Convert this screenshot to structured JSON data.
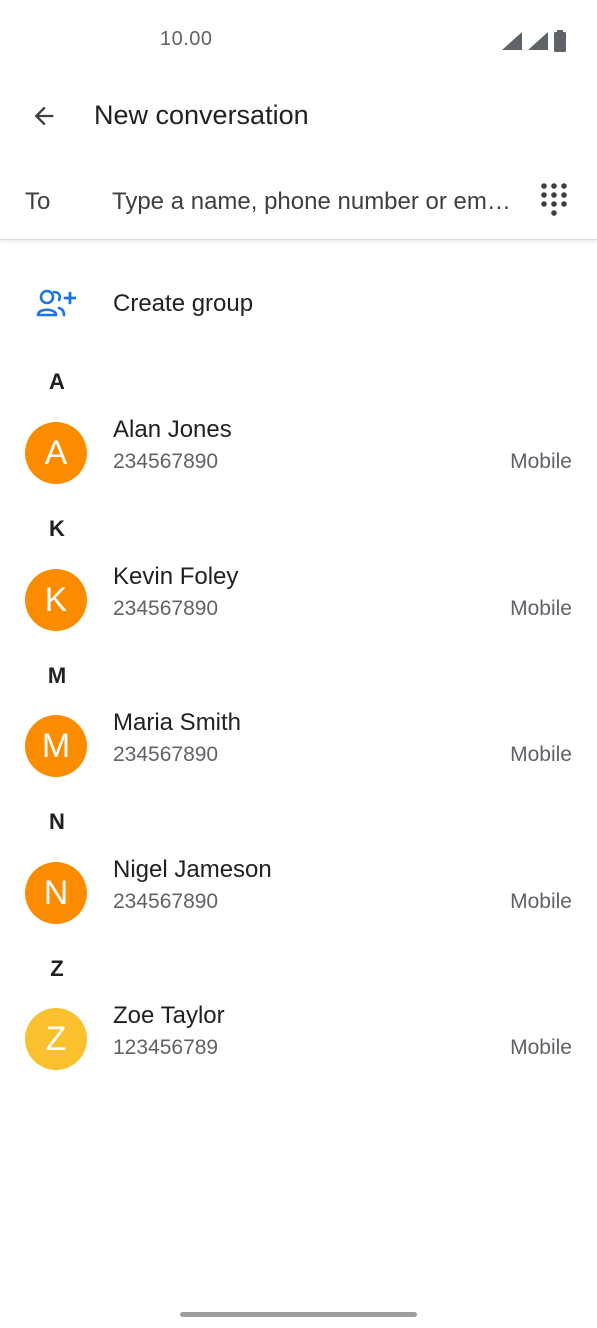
{
  "status_bar": {
    "time": "10.00",
    "icons": [
      "signal-icon",
      "signal-icon",
      "battery-icon"
    ]
  },
  "app_bar": {
    "title": "New conversation",
    "back_icon": "arrow-back-icon"
  },
  "recipient": {
    "label": "To",
    "placeholder": "Type a name, phone number or em…",
    "value": "",
    "dialpad_icon": "dialpad-icon"
  },
  "create_group": {
    "label": "Create group",
    "icon": "group-add-icon",
    "accent_color": "#1a73e8"
  },
  "sections": [
    {
      "letter": "A",
      "contacts": [
        {
          "initial": "A",
          "name": "Alan Jones",
          "number": "234567890",
          "type": "Mobile",
          "avatar_color": "#fb8c00"
        }
      ]
    },
    {
      "letter": "K",
      "contacts": [
        {
          "initial": "K",
          "name": "Kevin Foley",
          "number": "234567890",
          "type": "Mobile",
          "avatar_color": "#fb8c00"
        }
      ]
    },
    {
      "letter": "M",
      "contacts": [
        {
          "initial": "M",
          "name": "Maria Smith",
          "number": "234567890",
          "type": "Mobile",
          "avatar_color": "#fb8c00"
        }
      ]
    },
    {
      "letter": "N",
      "contacts": [
        {
          "initial": "N",
          "name": "Nigel Jameson",
          "number": "234567890",
          "type": "Mobile",
          "avatar_color": "#fb8c00"
        }
      ]
    },
    {
      "letter": "Z",
      "contacts": [
        {
          "initial": "Z",
          "name": "Zoe Taylor",
          "number": "123456789",
          "type": "Mobile",
          "avatar_color": "#fbc02d"
        }
      ]
    }
  ]
}
